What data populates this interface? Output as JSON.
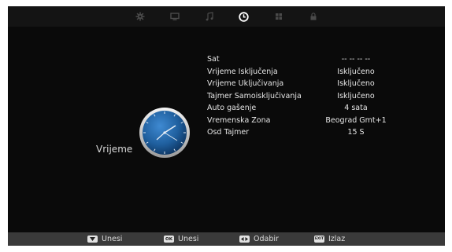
{
  "tabs": [
    {
      "icon": "gear-icon",
      "active": false
    },
    {
      "icon": "monitor-icon",
      "active": false
    },
    {
      "icon": "music-note-icon",
      "active": false
    },
    {
      "icon": "clock-icon",
      "active": true
    },
    {
      "icon": "grid-icon",
      "active": false
    },
    {
      "icon": "lock-icon",
      "active": false
    }
  ],
  "panel": {
    "title": "Vrijeme"
  },
  "menu": [
    {
      "label": "Sat",
      "value": "-- --   -- --"
    },
    {
      "label": "Vrijeme Isključenja",
      "value": "Isključeno"
    },
    {
      "label": "Vrijeme Uključivanja",
      "value": "Isključeno"
    },
    {
      "label": "Tajmer Samoisključivanja",
      "value": "Isključeno"
    },
    {
      "label": "Auto gašenje",
      "value": "4 sata"
    },
    {
      "label": "Vremenska Zona",
      "value": "Beograd Gmt+1"
    },
    {
      "label": "Osd Tajmer",
      "value": "15 S"
    }
  ],
  "footer": [
    {
      "key": "down-arrow",
      "label": "Unesi"
    },
    {
      "key": "OK",
      "label": "Unesi"
    },
    {
      "key": "left-right-arrows",
      "label": "Odabir"
    },
    {
      "key": "EXIT",
      "label": "Izlaz"
    }
  ],
  "colors": {
    "screen_bg": "#0a0a0a",
    "topbar_bg": "#141414",
    "footer_bg": "#3a3a3a",
    "clock_face": "#1f5f9e",
    "active_icon": "#ffffff",
    "inactive_icon": "#4a4a4a"
  }
}
